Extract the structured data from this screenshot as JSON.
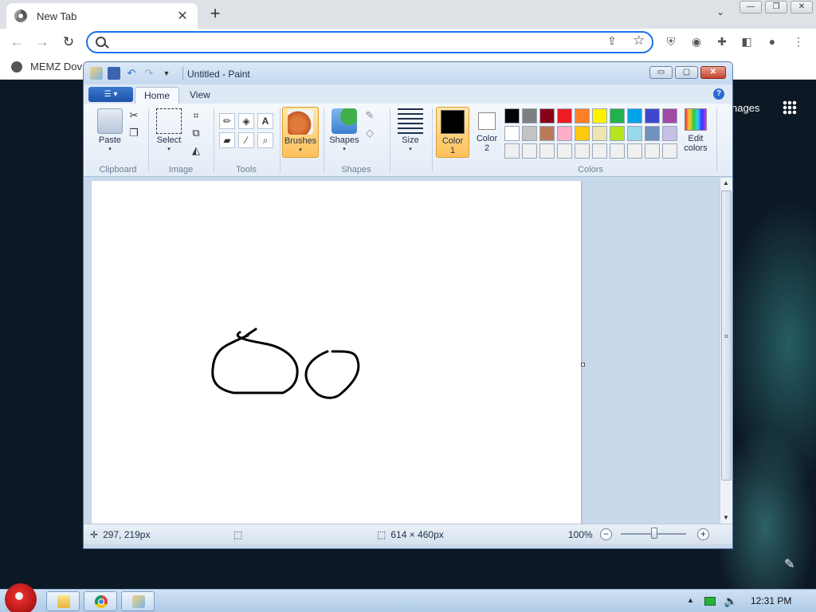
{
  "browser": {
    "tab_title": "New Tab",
    "tab_close": "✕",
    "new_tab": "+",
    "tab_search": "⌄",
    "window_controls": [
      "—",
      "❐",
      "✕"
    ],
    "nav": {
      "back": "←",
      "forward": "→",
      "reload": "↻"
    },
    "omnibox": {
      "value": "",
      "placeholder": ""
    },
    "bookmark_label": "MEMZ Dov",
    "toolbar_icons": [
      "ublock-icon",
      "flag-icon",
      "extensions-icon",
      "sidepanel-icon",
      "profile-icon",
      "menu-icon"
    ]
  },
  "newtab": {
    "images_link": "nages"
  },
  "paint": {
    "title": "Untitled - Paint",
    "window_controls": [
      "▭",
      "▢",
      "✕"
    ],
    "tabs": [
      "Home",
      "View"
    ],
    "groups": {
      "clipboard": "Clipboard",
      "image": "Image",
      "tools": "Tools",
      "shapes": "Shapes",
      "colors": "Colors"
    },
    "buttons": {
      "paste": "Paste",
      "select": "Select",
      "brushes": "Brushes",
      "shapes": "Shapes",
      "size": "Size",
      "color1": "Color\n1",
      "color2": "Color\n2",
      "edit_colors": "Edit\ncolors"
    },
    "color1": "#000000",
    "color2": "#ffffff",
    "palette": [
      "#000000",
      "#7f7f7f",
      "#880015",
      "#ed1c24",
      "#ff7f27",
      "#fff200",
      "#22b14c",
      "#00a2e8",
      "#3f48cc",
      "#a349a4",
      "#ffffff",
      "#c3c3c3",
      "#b97a57",
      "#ffaec9",
      "#ffc90e",
      "#efe4b0",
      "#b5e61d",
      "#99d9ea",
      "#7092be",
      "#c8bfe7",
      "#f0f0f0",
      "#f0f0f0",
      "#f0f0f0",
      "#f0f0f0",
      "#f0f0f0",
      "#f0f0f0",
      "#f0f0f0",
      "#f0f0f0",
      "#f0f0f0",
      "#f0f0f0"
    ],
    "status": {
      "cursor_pos": "297, 219px",
      "canvas_size": "614 × 460px",
      "zoom": "100%"
    }
  },
  "taskbar": {
    "clock": "12:31 PM"
  }
}
